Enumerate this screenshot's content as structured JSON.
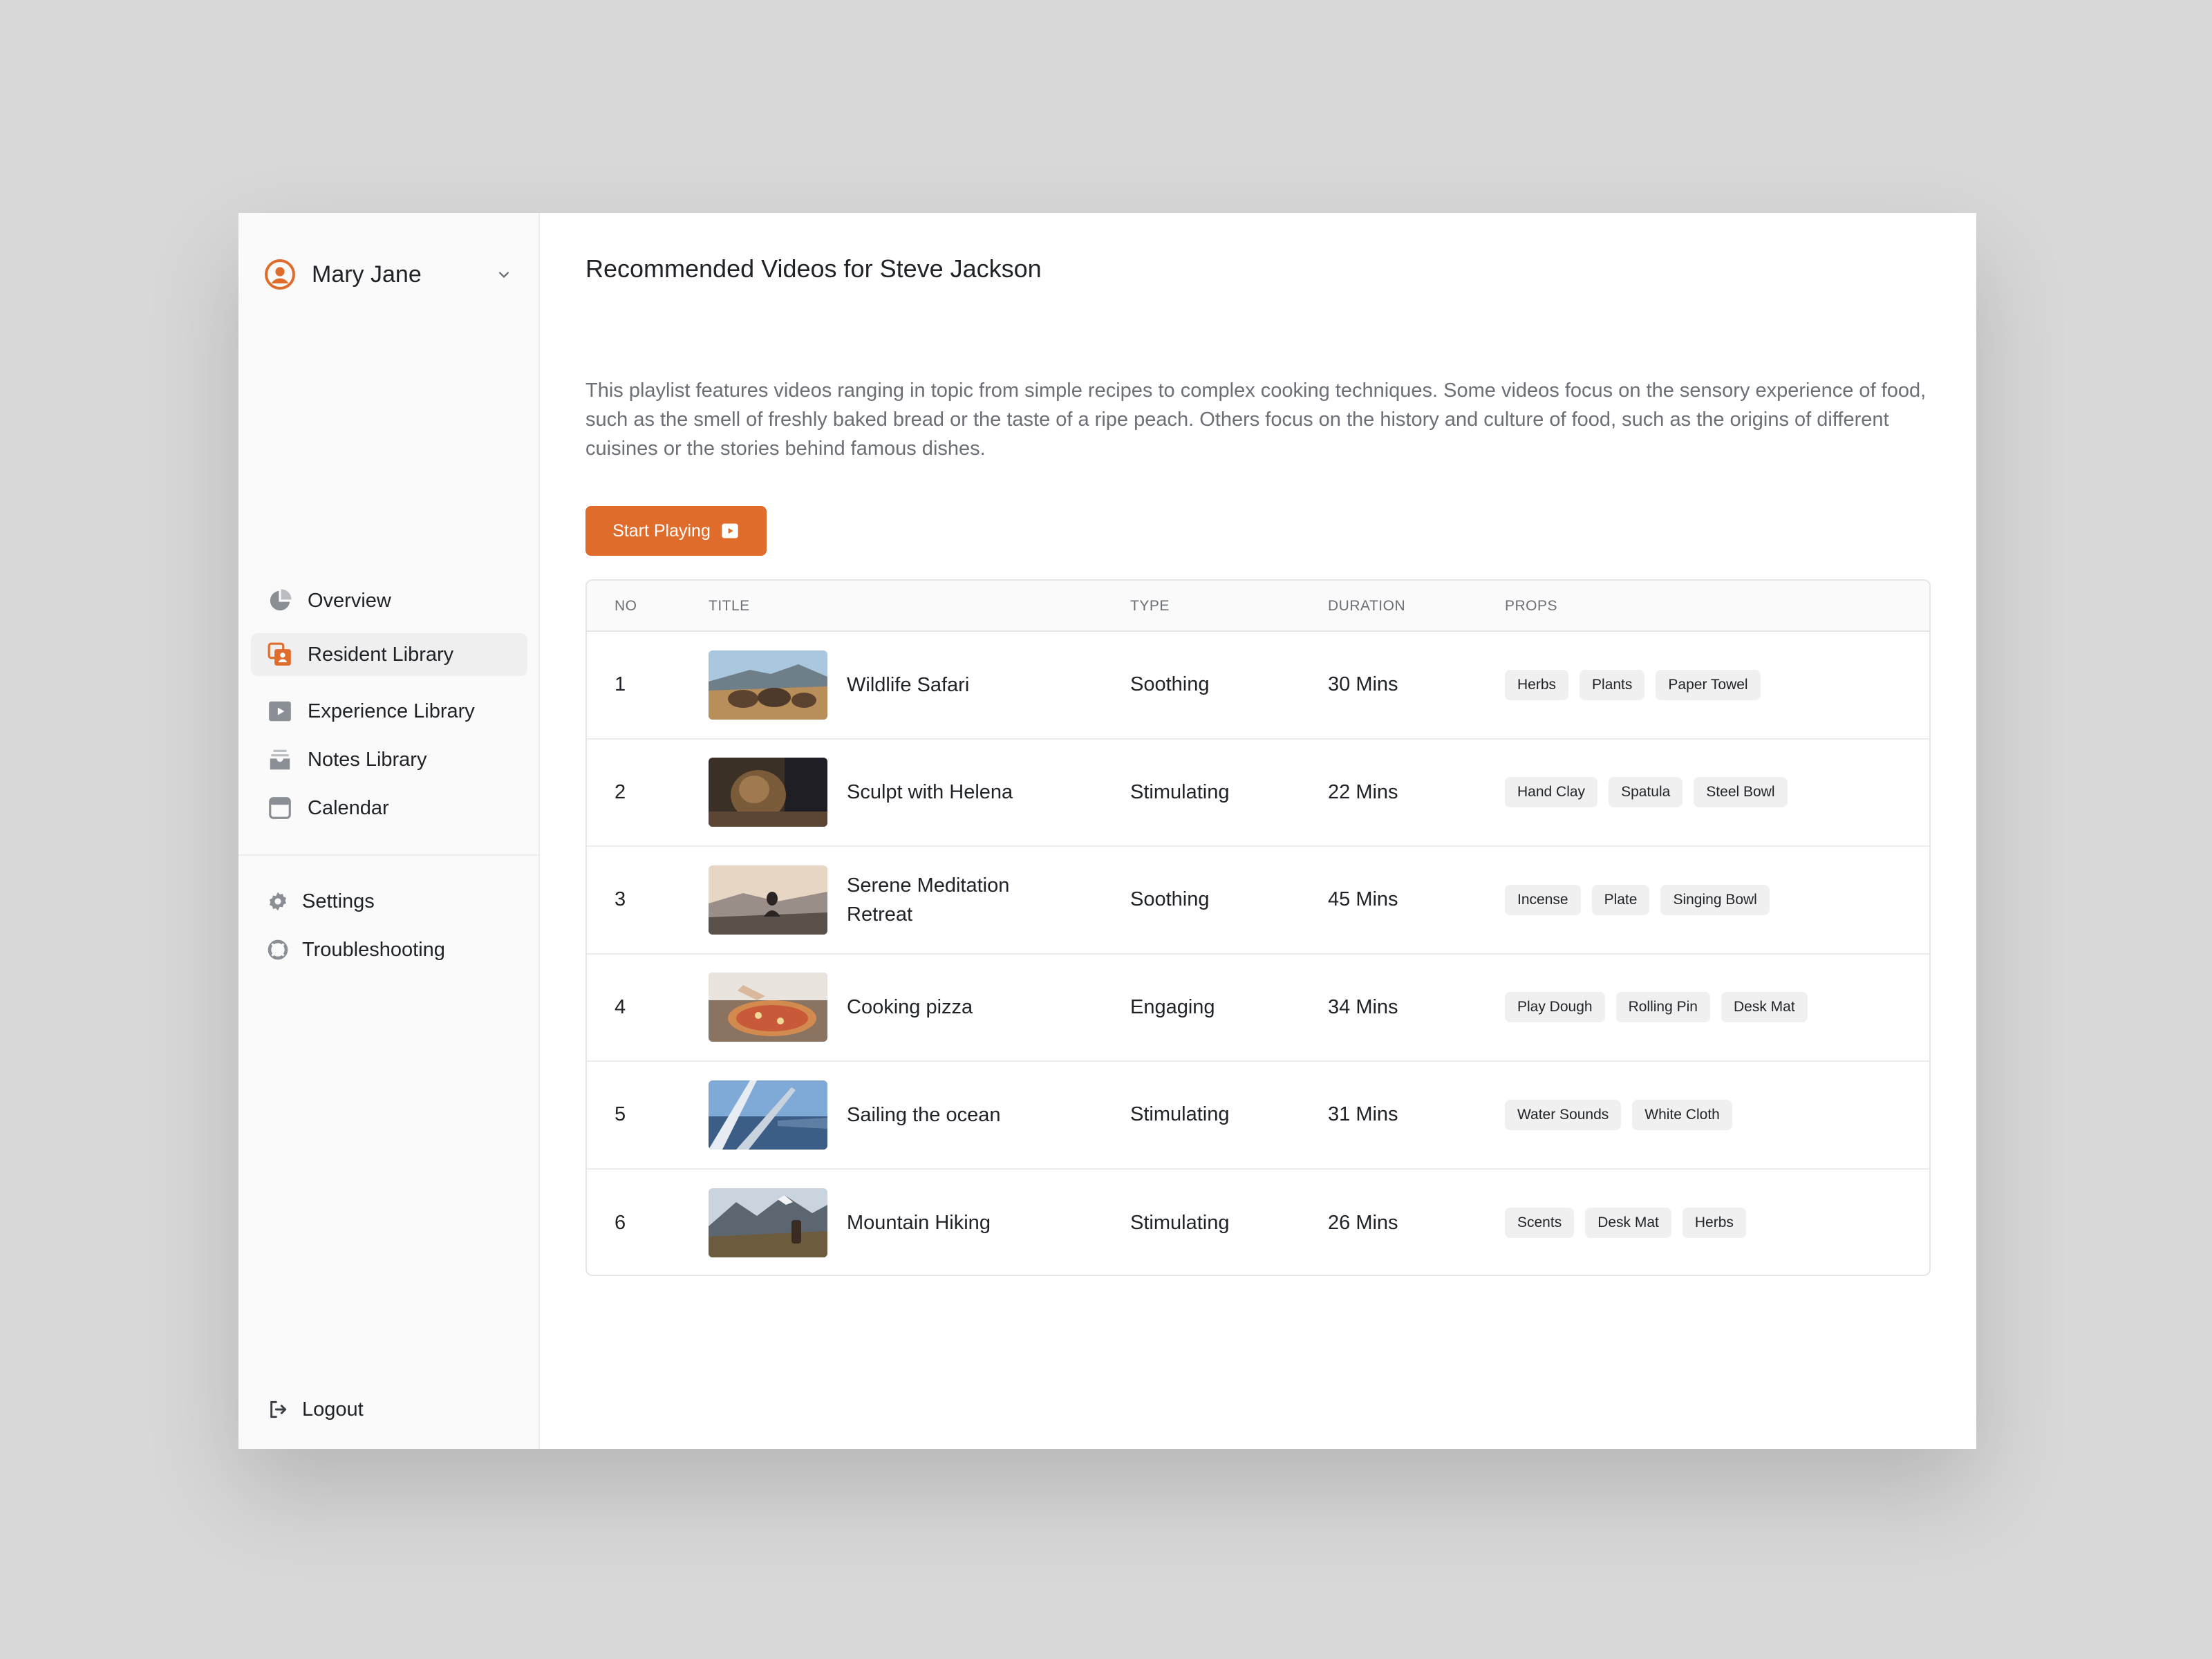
{
  "user": {
    "name": "Mary Jane"
  },
  "sidebar": {
    "items": [
      {
        "label": "Overview",
        "icon": "pie-chart-icon"
      },
      {
        "label": "Resident Library",
        "icon": "resident-library-icon",
        "active": true
      },
      {
        "label": "Experience Library",
        "icon": "play-box-icon"
      },
      {
        "label": "Notes Library",
        "icon": "inbox-icon"
      },
      {
        "label": "Calendar",
        "icon": "calendar-icon"
      }
    ],
    "secondary": [
      {
        "label": "Settings",
        "icon": "gear-icon"
      },
      {
        "label": "Troubleshooting",
        "icon": "lifebuoy-icon"
      }
    ],
    "logout": {
      "label": "Logout",
      "icon": "logout-icon"
    }
  },
  "main": {
    "title": "Recommended Videos for Steve Jackson",
    "description": "This playlist features videos ranging in topic from simple recipes to complex cooking techniques. Some videos focus on the sensory experience of food, such as the smell of freshly baked bread or the taste of a ripe peach. Others focus on the history and culture of food, such as the origins of different cuisines or the stories behind famous dishes.",
    "start_button": "Start Playing"
  },
  "table": {
    "headers": [
      "NO",
      "TITLE",
      "TYPE",
      "DURATION",
      "PROPS"
    ],
    "rows": [
      {
        "no": "1",
        "title": "Wildlife Safari",
        "type": "Soothing",
        "duration": "30 Mins",
        "props": [
          "Herbs",
          "Plants",
          "Paper Towel"
        ]
      },
      {
        "no": "2",
        "title": "Sculpt with Helena",
        "type": "Stimulating",
        "duration": "22 Mins",
        "props": [
          "Hand Clay",
          "Spatula",
          "Steel Bowl"
        ]
      },
      {
        "no": "3",
        "title": "Serene Meditation Retreat",
        "type": "Soothing",
        "duration": "45 Mins",
        "props": [
          "Incense",
          "Plate",
          "Singing Bowl"
        ]
      },
      {
        "no": "4",
        "title": "Cooking pizza",
        "type": "Engaging",
        "duration": "34 Mins",
        "props": [
          "Play Dough",
          "Rolling Pin",
          "Desk Mat"
        ]
      },
      {
        "no": "5",
        "title": "Sailing the ocean",
        "type": "Stimulating",
        "duration": "31 Mins",
        "props": [
          "Water Sounds",
          "White Cloth"
        ]
      },
      {
        "no": "6",
        "title": "Mountain Hiking",
        "type": "Stimulating",
        "duration": "26 Mins",
        "props": [
          "Scents",
          "Desk Mat",
          "Herbs"
        ]
      }
    ]
  },
  "colors": {
    "accent": "#e06c2c",
    "icon_gray": "#8a8f96"
  }
}
